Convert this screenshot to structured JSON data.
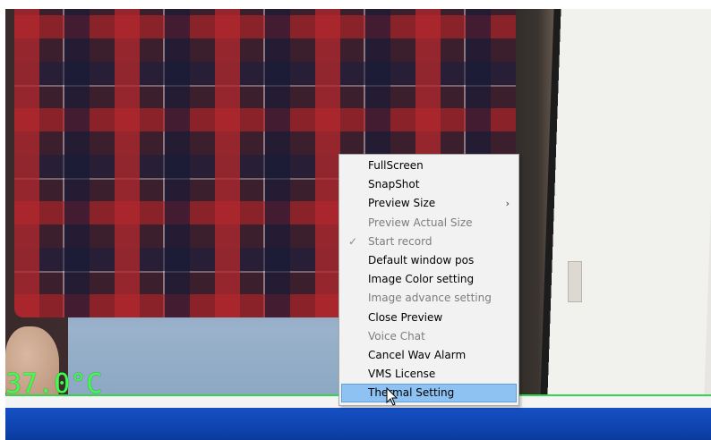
{
  "overlay": {
    "temperature": "37.0°C",
    "temperature_color": "#3cff4b"
  },
  "context_menu": {
    "items": [
      {
        "label": "FullScreen",
        "enabled": true
      },
      {
        "label": "SnapShot",
        "enabled": true
      },
      {
        "label": "Preview Size",
        "enabled": true,
        "submenu": true,
        "submenu_icon": "chevron-right-icon"
      },
      {
        "label": "Preview Actual Size",
        "enabled": false
      },
      {
        "label": "Start record",
        "enabled": false,
        "checked": true,
        "check_icon": "checkmark-icon"
      },
      {
        "label": "Default window pos",
        "enabled": true
      },
      {
        "label": "Image Color setting",
        "enabled": true
      },
      {
        "label": "Image advance setting",
        "enabled": false
      },
      {
        "label": "Close Preview",
        "enabled": true
      },
      {
        "label": "Voice Chat",
        "enabled": false
      },
      {
        "label": "Cancel Wav Alarm",
        "enabled": true
      },
      {
        "label": "VMS License",
        "enabled": true
      },
      {
        "label": "Thermal Setting",
        "enabled": true,
        "highlighted": true
      }
    ],
    "highlight_color": "#8ec2f2"
  },
  "taskbar": {
    "color": "#1550c4"
  },
  "pointer": {
    "icon": "mouse-pointer-icon"
  }
}
